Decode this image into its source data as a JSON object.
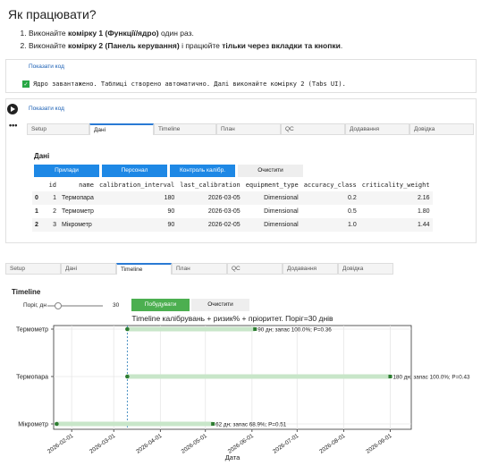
{
  "heading": "Як працювати?",
  "steps": [
    {
      "pre": "Виконайте ",
      "bold": "комірку 1 (Функції/ядро)",
      "mid": " один раз.",
      "bold2": "",
      "post": ""
    },
    {
      "pre": "Виконайте ",
      "bold": "комірку 2 (Панель керування)",
      "mid": " і працюйте ",
      "bold2": "тільки через вкладки та кнопки",
      "post": "."
    }
  ],
  "cell1": {
    "link": "Показати код",
    "output": "Ядро завантажено. Таблиці створено автоматично. Далі виконайте комірку 2 (Tabs UI)."
  },
  "cell2": {
    "link": "Показати код",
    "dots": "•••"
  },
  "tabs": [
    "Setup",
    "Дані",
    "Timeline",
    "План",
    "QC",
    "Додавання",
    "Довідка"
  ],
  "data_tab": {
    "title": "Дані",
    "buttons": [
      "Прилади",
      "Персонал",
      "Контроль калібр.",
      "Очистити"
    ],
    "columns": [
      "",
      "id",
      "name",
      "calibration_interval",
      "last_calibration",
      "equipment_type",
      "accuracy_class",
      "criticality_weight"
    ],
    "rows": [
      [
        "0",
        "1",
        "Термопара",
        "180",
        "2026-03-05",
        "Dimensional",
        "0.2",
        "2.16"
      ],
      [
        "1",
        "2",
        "Термометр",
        "90",
        "2026-03-05",
        "Dimensional",
        "0.5",
        "1.80"
      ],
      [
        "2",
        "3",
        "Мікрометр",
        "90",
        "2026-02-05",
        "Dimensional",
        "1.0",
        "1.44"
      ]
    ]
  },
  "timeline_tab": {
    "title": "Timeline",
    "threshold_label": "Поріг, дн",
    "threshold_value": "30",
    "btn_build": "Побудувати",
    "btn_clear": "Очистити"
  },
  "colors": {
    "accent": "#1e88e5",
    "green": "#4caf50",
    "bar": "#c8e6c9",
    "dot": "#2e7d32",
    "today_line": "#1f77b4"
  },
  "chart_data": {
    "type": "bar",
    "title": "Timeline калібрувань  + ризик% + пріоритет. Поріг=30 днів",
    "xlabel": "Дата",
    "ylabel": "",
    "xlim": [
      "2026-01-20",
      "2026-09-15"
    ],
    "x_ticks": [
      "2026-02-01",
      "2026-03-01",
      "2026-04-01",
      "2026-05-01",
      "2026-06-01",
      "2026-07-01",
      "2026-08-01",
      "2026-09-01"
    ],
    "today": "2026-03-10",
    "grid": true,
    "series": [
      {
        "name": "Термометр",
        "start": "2026-03-10",
        "end": "2026-06-03",
        "label": "90 дн; запас 100.0%; P=0.36"
      },
      {
        "name": "Термопара",
        "start": "2026-03-10",
        "end": "2026-09-01",
        "label": "180 дн; запас 100.0%; P=0.43"
      },
      {
        "name": "Мікрометр",
        "start": "2026-01-22",
        "end": "2026-05-06",
        "label": "62 дн; запас 68.9%; P=0.51"
      }
    ]
  }
}
